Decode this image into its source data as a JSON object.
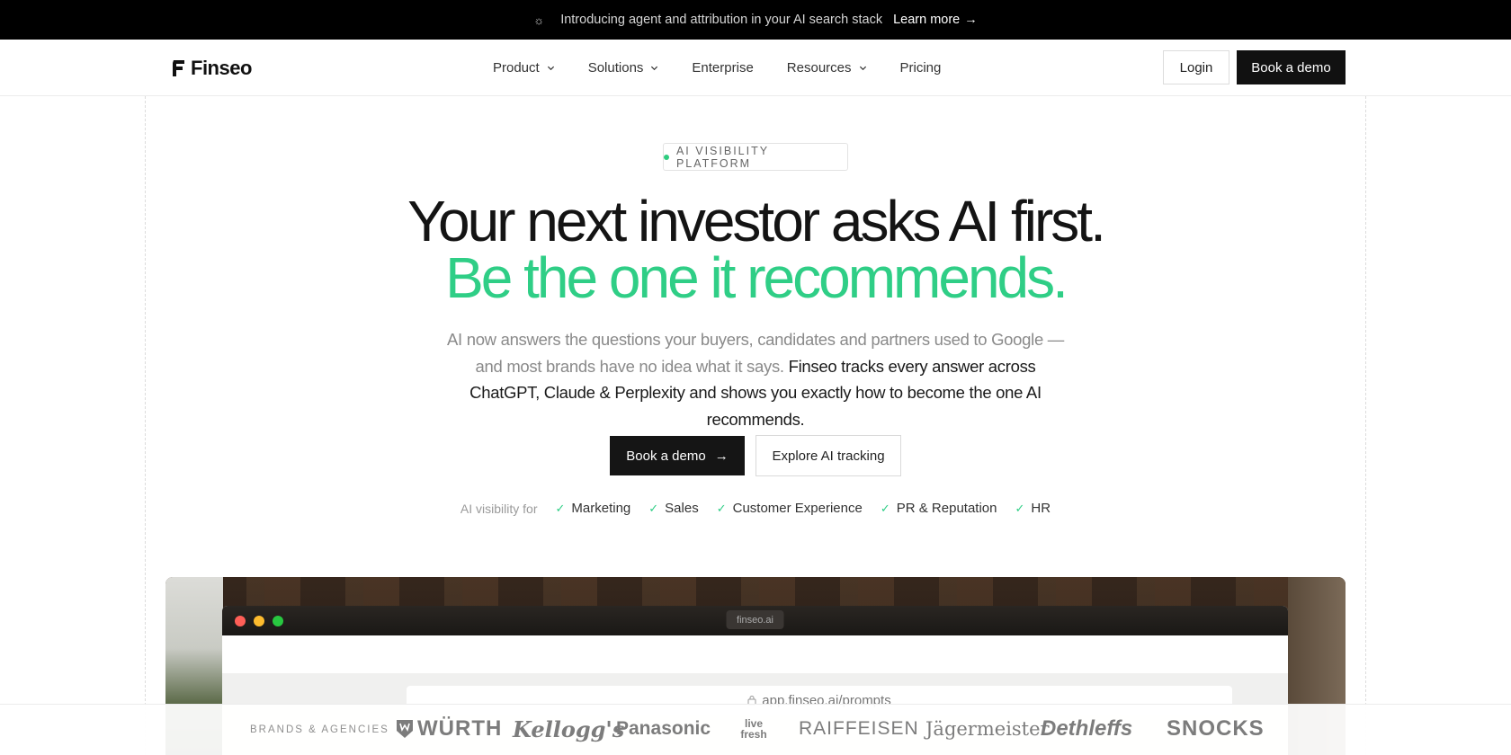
{
  "announcement": {
    "text": "Introducing agent and attribution in your AI search stack",
    "link_label": "Learn more"
  },
  "nav": {
    "brand": "Finseo",
    "items": [
      {
        "label": "Product",
        "dropdown": true
      },
      {
        "label": "Solutions",
        "dropdown": true
      },
      {
        "label": "Enterprise",
        "dropdown": false
      },
      {
        "label": "Resources",
        "dropdown": true
      },
      {
        "label": "Pricing",
        "dropdown": false
      }
    ],
    "login_label": "Login",
    "demo_label": "Book a demo"
  },
  "hero": {
    "badge": "AI VISIBILITY PLATFORM",
    "headline_1": "Your next investor asks AI first.",
    "headline_2": "Be the one it recommends.",
    "sub_muted": "AI now answers the questions your buyers, candidates and partners used to Google — and most brands have no idea what it says.",
    "sub_strong": "Finseo tracks every answer across ChatGPT, Claude & Perplexity and shows you exactly how to become the one AI recommends.",
    "cta_primary": "Book a demo",
    "cta_secondary": "Explore AI tracking",
    "usecase_lead": "AI visibility for",
    "usecases": [
      "Marketing",
      "Sales",
      "Customer Experience",
      "PR & Reputation",
      "HR"
    ]
  },
  "preview": {
    "window_title": "finseo.ai",
    "url": "app.finseo.ai/prompts"
  },
  "logos": {
    "label": "BRANDS & AGENCIES",
    "brands": [
      "WÜRTH",
      "Kellogg's",
      "Panasonic",
      "live fresh",
      "RAIFFEISEN",
      "Jägermeister",
      "Dethleffs",
      "SNOCKS"
    ]
  },
  "colors": {
    "accent_green": "#2fce86",
    "dark": "#111111",
    "announcement_bg": "#000000"
  }
}
